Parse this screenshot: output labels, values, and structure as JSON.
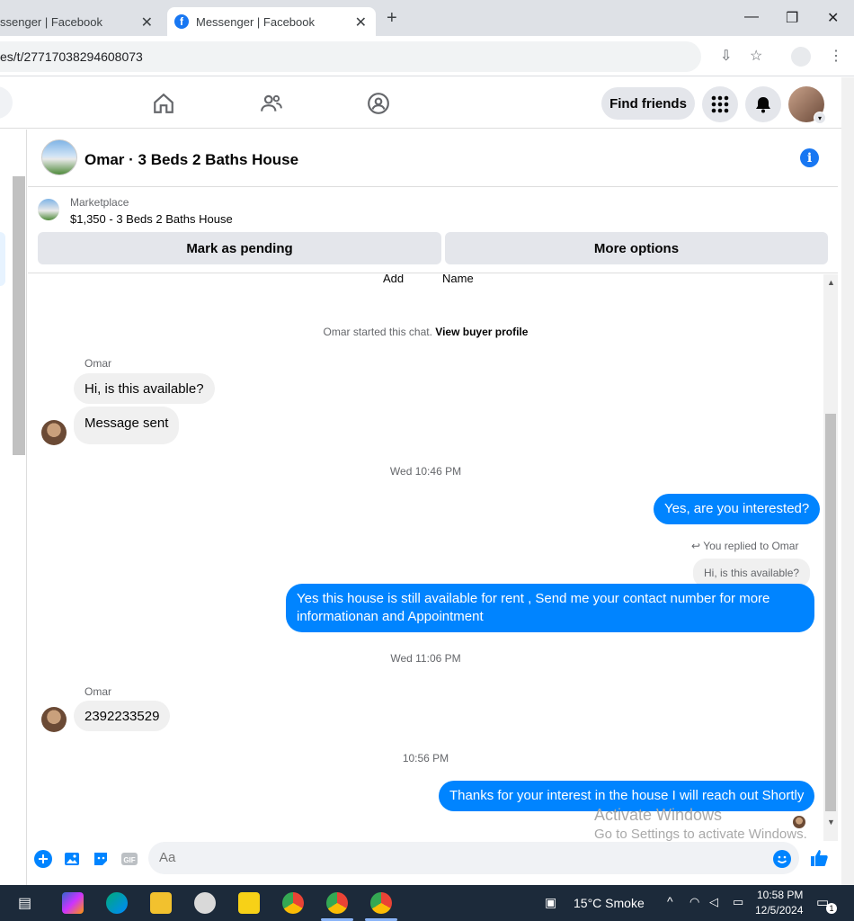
{
  "browser": {
    "tabs": [
      {
        "title": "ssenger | Facebook"
      },
      {
        "title": "Messenger | Facebook"
      }
    ],
    "address": "es/t/27717038294608073"
  },
  "nav": {
    "find_friends": "Find friends"
  },
  "chat": {
    "title": "Omar · 3 Beds 2 Baths House",
    "marketplace_label": "Marketplace",
    "listing": "$1,350 - 3 Beds 2 Baths House",
    "mark_pending": "Mark as pending",
    "more_options": "More options",
    "top_partial": [
      "Add",
      "Name"
    ],
    "started_prefix": "Omar started this chat.",
    "view_profile": "View buyer profile",
    "sender_name": "Omar",
    "msg1": "Hi, is this available?",
    "msg2": "Message sent",
    "time1": "Wed 10:46 PM",
    "out1": "Yes, are you interested?",
    "replied_to": "You replied to Omar",
    "quote": "Hi, is this available?",
    "out2": "Yes this house is still available for rent , Send me your contact number for more informationan and Appointment",
    "time2": "Wed 11:06 PM",
    "sender_name2": "Omar",
    "msg3": "2392233529",
    "time3": "10:56 PM",
    "out3": "Thanks for your interest in the house I will reach out Shortly",
    "composer_placeholder": "Aa"
  },
  "watermark": {
    "line1": "Activate Windows",
    "line2": "Go to Settings to activate Windows."
  },
  "taskbar": {
    "weather": "15°C  Smoke",
    "time": "10:58 PM",
    "date": "12/5/2024",
    "notif_count": "1"
  },
  "colors": {
    "accent": "#0084ff",
    "fb_blue": "#1877f2"
  }
}
